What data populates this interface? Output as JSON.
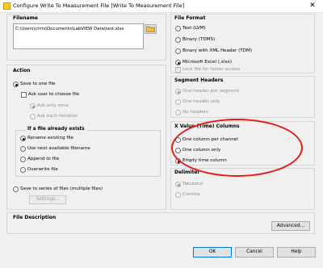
{
  "window": {
    "title": "Configure Write To Measurement File [Write To Measurement File]",
    "close_glyph": "✕"
  },
  "filename": {
    "header": "Filename",
    "value": "C:\\Users\\chris\\Documents\\LabVIEW Data\\test.xlsx"
  },
  "action": {
    "header": "Action",
    "save_one_file": "Save to one file",
    "ask_user": "Ask user to choose file",
    "ask_only_once": "Ask only once",
    "ask_each_iteration": "Ask each iteration",
    "if_exists": {
      "title": "If a file already exists",
      "options": [
        "Rename existing file",
        "Use next available filename",
        "Append to file",
        "Overwrite file"
      ]
    },
    "save_series": "Save to series of files (multiple files)",
    "settings_button": "Settings..."
  },
  "file_format": {
    "header": "File Format",
    "options": [
      "Text (LVM)",
      "Binary (TDMS)",
      "Binary with XML Header (TDM)",
      "Microsoft Excel (.xlsx)"
    ],
    "lock_label": "Lock file for faster access"
  },
  "segment_headers": {
    "header": "Segment Headers",
    "options": [
      "One header per segment",
      "One header only",
      "No headers"
    ]
  },
  "x_value": {
    "header": "X Value (Time) Columns",
    "options": [
      "One column per channel",
      "One column only",
      "Empty time column"
    ]
  },
  "delimiter": {
    "header": "Delimiter",
    "options": [
      "Tabulator",
      "Comma"
    ]
  },
  "file_description": {
    "header": "File Description",
    "advanced_button": "Advanced..."
  },
  "buttons": {
    "ok": "OK",
    "cancel": "Cancel",
    "help": "Help"
  },
  "colors": {
    "highlight": "#e31b1b",
    "folder": "#e8c04a"
  },
  "icons": [
    "folder-browse-icon",
    "close-icon",
    "app-icon"
  ]
}
